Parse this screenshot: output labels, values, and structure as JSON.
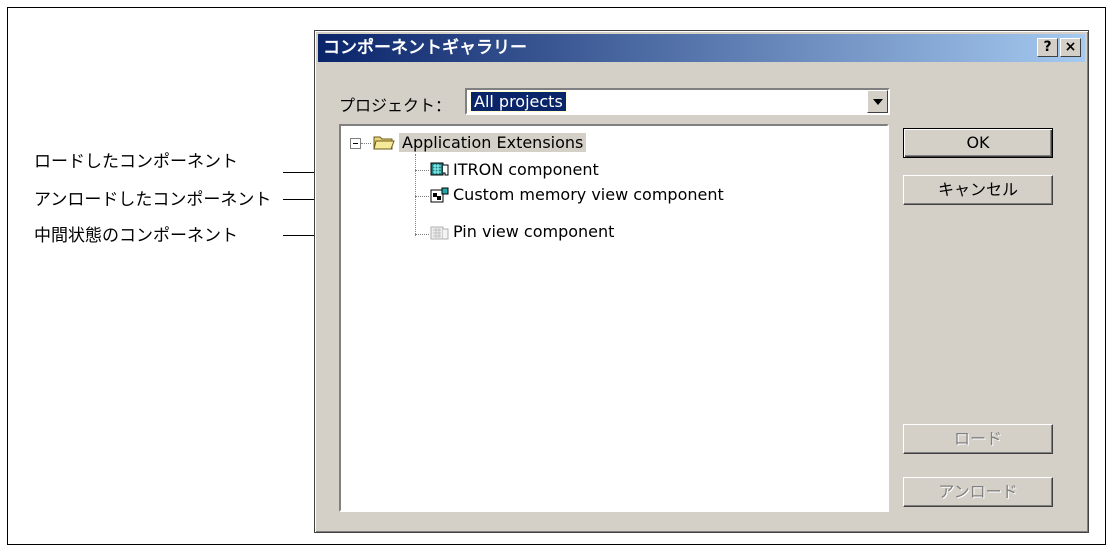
{
  "annotations": {
    "loaded": "ロードしたコンポーネント",
    "unloaded": "アンロードしたコンポーネント",
    "intermediate": "中間状態のコンポーネント"
  },
  "dialog": {
    "title": "コンポーネントギャラリー",
    "help_button": "?",
    "close_button": "×",
    "project_label": "プロジェクト：",
    "project_value": "All projects",
    "tree": {
      "root": "Application Extensions",
      "items": [
        {
          "label": "ITRON component",
          "state": "loaded",
          "icon": "component-loaded-icon"
        },
        {
          "label": "Custom memory view component",
          "state": "unloaded",
          "icon": "component-unloaded-icon"
        },
        {
          "label": "Pin view component",
          "state": "intermediate",
          "icon": "component-intermediate-icon"
        }
      ]
    },
    "buttons": {
      "ok": "OK",
      "cancel": "キャンセル",
      "load": "ロード",
      "unload": "アンロード"
    }
  },
  "colors": {
    "title_gradient_start": "#0a246a",
    "title_gradient_end": "#a6caf0",
    "dialog_face": "#d4d0c8",
    "selection": "#0a246a",
    "disabled_text": "#808080"
  }
}
